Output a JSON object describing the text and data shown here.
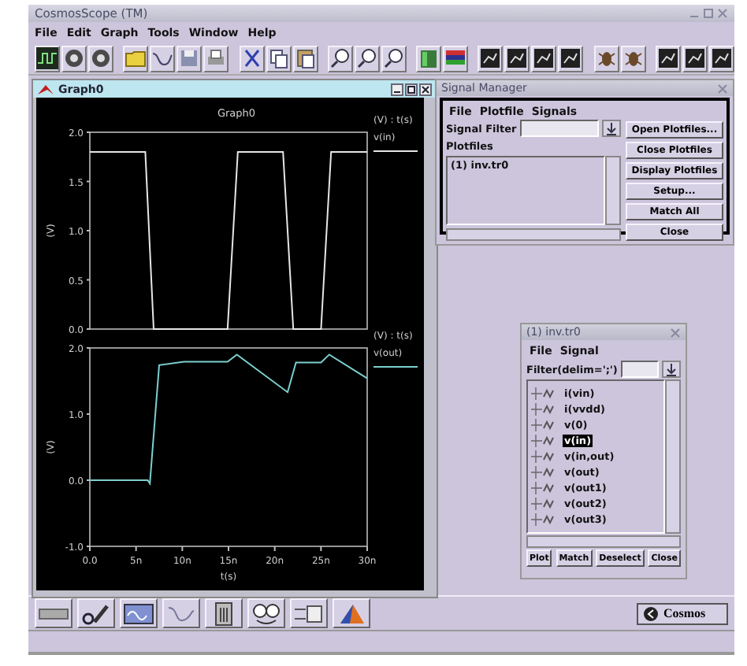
{
  "app": {
    "title": "CosmosScope (TM)"
  },
  "menu": [
    "File",
    "Edit",
    "Graph",
    "Tools",
    "Window",
    "Help"
  ],
  "graph_window": {
    "title": "Graph0",
    "graph_title": "Graph0",
    "panels": [
      {
        "axis_units": "(V) : t(s)",
        "chart_data": {
          "type": "line",
          "ylabel": "(V)",
          "x": [
            0,
            6,
            6.9,
            14.9,
            16,
            20.9,
            22,
            25,
            26.1,
            30
          ],
          "series": [
            {
              "name": "v(in)",
              "color": "#e6e6e6",
              "values": [
                1.8,
                1.8,
                0,
                0,
                1.8,
                1.8,
                0,
                0,
                1.8,
                1.8
              ]
            }
          ],
          "xlim": [
            0,
            30
          ],
          "ylim": [
            0,
            2
          ],
          "yticks": [
            {
              "value": 0,
              "label": "0.0"
            },
            {
              "value": 0.5,
              "label": "0.5"
            },
            {
              "value": 1,
              "label": "1.0"
            },
            {
              "value": 1.5,
              "label": "1.5"
            },
            {
              "value": 2,
              "label": "2.0"
            }
          ]
        }
      },
      {
        "axis_units": "(V) : t(s)",
        "chart_data": {
          "type": "line",
          "ylabel": "(V)",
          "xlabel": "t(s)",
          "x": [
            0,
            6.25,
            6.5,
            7.5,
            10.2,
            14.9,
            15.9,
            21.4,
            22.3,
            25,
            25.9,
            30
          ],
          "series": [
            {
              "name": "v(out)",
              "color": "#7ccfcf",
              "values": [
                0,
                0,
                -0.05,
                1.74,
                1.79,
                1.79,
                1.9,
                1.33,
                1.78,
                1.78,
                1.9,
                1.54
              ]
            }
          ],
          "xlim": [
            0,
            30
          ],
          "ylim": [
            -1,
            2
          ],
          "xticks": [
            {
              "value": 0,
              "label": "0.0"
            },
            {
              "value": 5,
              "label": "5n"
            },
            {
              "value": 10,
              "label": "10n"
            },
            {
              "value": 15,
              "label": "15n"
            },
            {
              "value": 20,
              "label": "20n"
            },
            {
              "value": 25,
              "label": "25n"
            },
            {
              "value": 30,
              "label": "30n"
            }
          ],
          "yticks": [
            {
              "value": -1,
              "label": "-1.0"
            },
            {
              "value": 0,
              "label": "0.0"
            },
            {
              "value": 1,
              "label": "1.0"
            },
            {
              "value": 2,
              "label": "2.0"
            }
          ]
        }
      }
    ]
  },
  "signal_manager": {
    "title": "Signal Manager",
    "menu": [
      "File",
      "Plotfile",
      "Signals"
    ],
    "filter_label": "Signal Filter",
    "plotfiles_label": "Plotfiles",
    "plotfiles": [
      "(1) inv.tr0"
    ],
    "buttons": [
      "Open Plotfiles...",
      "Close Plotfiles",
      "Display Plotfiles",
      "Setup...",
      "Match All",
      "Close"
    ]
  },
  "signal_window": {
    "title": "(1) inv.tr0",
    "menu": [
      "File",
      "Signal"
    ],
    "filter_label": "Filter(delim=';')",
    "signals": [
      {
        "name": "i(vin)",
        "selected": false
      },
      {
        "name": "i(vvdd)",
        "selected": false
      },
      {
        "name": "v(0)",
        "selected": false
      },
      {
        "name": "v(in)",
        "selected": true
      },
      {
        "name": "v(in,out)",
        "selected": false
      },
      {
        "name": "v(out)",
        "selected": false
      },
      {
        "name": "v(out1)",
        "selected": false
      },
      {
        "name": "v(out2)",
        "selected": false
      },
      {
        "name": "v(out3)",
        "selected": false
      }
    ],
    "buttons": [
      "Plot",
      "Match",
      "Deselect",
      "Close"
    ]
  },
  "bottom_toolbar": {
    "brand_button": "Cosmos"
  }
}
